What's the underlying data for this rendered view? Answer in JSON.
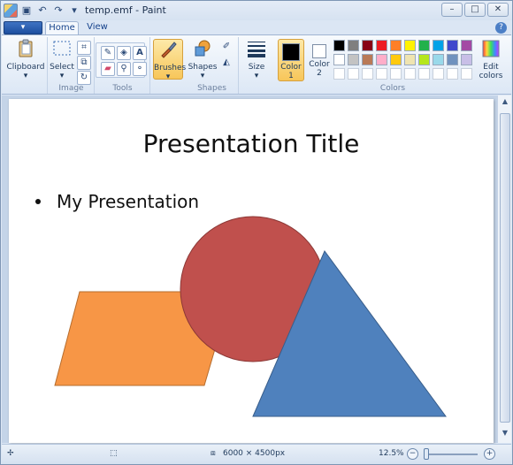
{
  "window": {
    "title": "temp.emf - Paint"
  },
  "ribbon": {
    "paint_menu_label": "▾",
    "tabs": [
      "Home",
      "View"
    ],
    "groups": {
      "clipboard": {
        "button": "Clipboard"
      },
      "image": {
        "select": "Select",
        "label": "Image"
      },
      "tools": {
        "label": "Tools"
      },
      "brushes": {
        "button": "Brushes"
      },
      "shapes": {
        "button": "Shapes",
        "label": "Shapes"
      },
      "size": {
        "button": "Size"
      },
      "colors": {
        "color1": "Color 1",
        "color2": "Color 2",
        "edit": "Edit colors",
        "label": "Colors",
        "color1_value": "#000000",
        "color2_value": "#ffffff",
        "palette_row1": [
          "#000000",
          "#7f7f7f",
          "#880015",
          "#ed1c24",
          "#ff7f27",
          "#fff200",
          "#22b14c",
          "#00a2e8",
          "#3f48cc",
          "#a349a4"
        ],
        "palette_row2": [
          "#ffffff",
          "#c3c3c3",
          "#b97a57",
          "#ffaec9",
          "#ffc90e",
          "#efe4b0",
          "#b5e61d",
          "#99d9ea",
          "#7092be",
          "#c8bfe7"
        ]
      }
    }
  },
  "canvas": {
    "title": "Presentation Title",
    "bullet": "My Presentation",
    "shape_colors": {
      "parallelogram": "#f79646",
      "circle": "#c0504d",
      "triangle": "#4f81bd"
    }
  },
  "status": {
    "dimensions": "6000 × 4500px",
    "zoom": "12.5%"
  }
}
